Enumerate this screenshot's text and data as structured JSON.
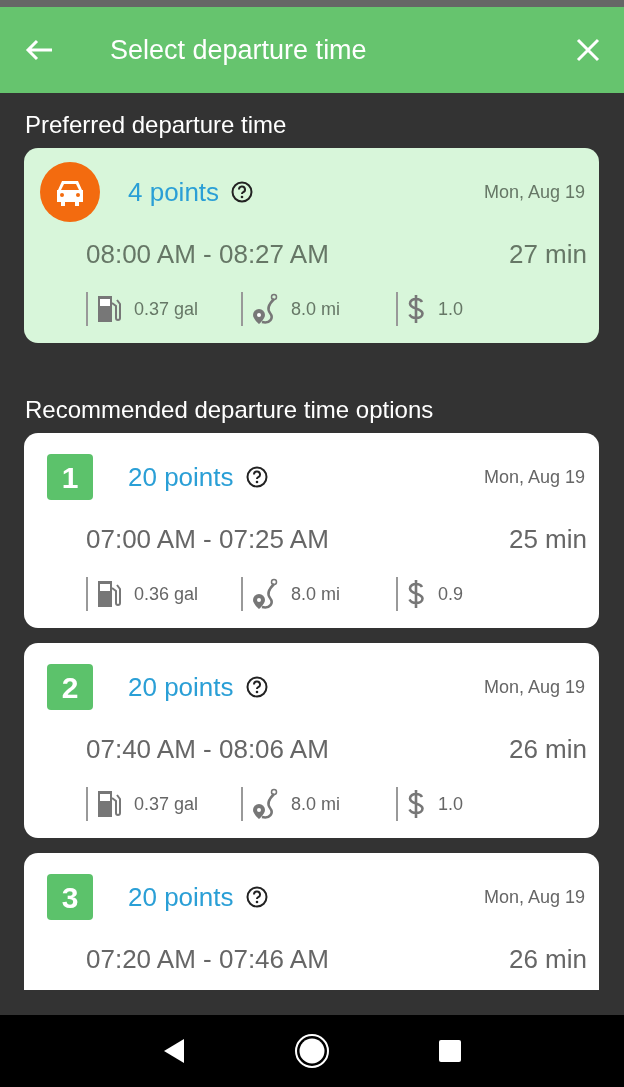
{
  "app_bar": {
    "title": "Select departure time"
  },
  "preferred": {
    "heading": "Preferred departure time",
    "card": {
      "kind": "preferred",
      "points": "4 points",
      "date": "Mon, Aug 19",
      "time_range": "08:00 AM - 08:27 AM",
      "duration": "27 min",
      "stats": {
        "fuel": "0.37 gal",
        "distance": "8.0 mi",
        "cost": "1.0"
      }
    }
  },
  "recommended": {
    "heading": "Recommended departure time options",
    "cards": [
      {
        "kind": "option",
        "rank": "1",
        "points": "20 points",
        "date": "Mon, Aug 19",
        "time_range": "07:00 AM - 07:25 AM",
        "duration": "25 min",
        "stats": {
          "fuel": "0.36 gal",
          "distance": "8.0 mi",
          "cost": "0.9"
        }
      },
      {
        "kind": "option",
        "rank": "2",
        "points": "20 points",
        "date": "Mon, Aug 19",
        "time_range": "07:40 AM - 08:06 AM",
        "duration": "26 min",
        "stats": {
          "fuel": "0.37 gal",
          "distance": "8.0 mi",
          "cost": "1.0"
        }
      },
      {
        "kind": "option",
        "rank": "3",
        "points": "20 points",
        "date": "Mon, Aug 19",
        "time_range": "07:20 AM - 07:46 AM",
        "duration": "26 min"
      }
    ]
  }
}
